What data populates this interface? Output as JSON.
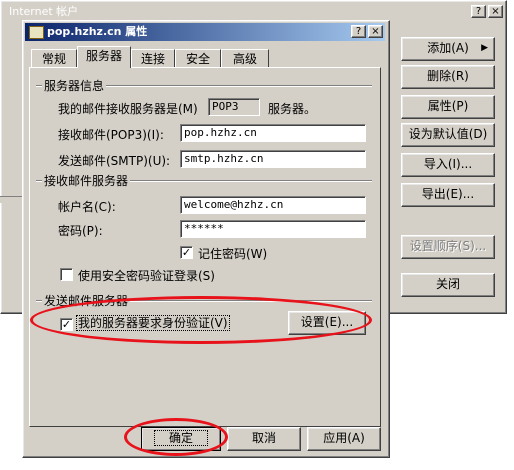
{
  "back_window": {
    "title": "Internet 帐户",
    "help_btn": "?",
    "close_btn": "×",
    "side_buttons": {
      "add": "添加(A)",
      "add_arrow": "▶",
      "remove": "删除(R)",
      "properties": "属性(P)",
      "set_default": "设为默认值(D)",
      "import": "导入(I)...",
      "export": "导出(E)...",
      "set_order": "设置顺序(S)...",
      "close": "关闭"
    }
  },
  "dialog": {
    "title": "pop.hzhz.cn 属性",
    "help_btn": "?",
    "close_btn": "×",
    "tabs": [
      "常规",
      "服务器",
      "连接",
      "安全",
      "高级"
    ],
    "active_tab": "服务器",
    "server_info": {
      "heading": "服务器信息",
      "incoming_type_label": "我的邮件接收服务器是(M)",
      "incoming_type_value": "POP3",
      "incoming_type_suffix": "服务器。",
      "pop3_label": "接收邮件(POP3)(I):",
      "pop3_value": "pop.hzhz.cn",
      "smtp_label": "发送邮件(SMTP)(U):",
      "smtp_value": "smtp.hzhz.cn"
    },
    "incoming": {
      "heading": "接收邮件服务器",
      "account_label": "帐户名(C):",
      "account_value": "welcome@hzhz.cn",
      "password_label": "密码(P):",
      "password_value": "******",
      "remember_label": "记住密码(W)",
      "remember_checked": "✓",
      "spa_label": "使用安全密码验证登录(S)",
      "spa_checked": ""
    },
    "outgoing": {
      "heading": "发送邮件服务器",
      "auth_label": "我的服务器要求身份验证(V)",
      "auth_checked": "✓",
      "settings_button": "设置(E)..."
    },
    "buttons": {
      "ok": "确定",
      "cancel": "取消",
      "apply": "应用(A)"
    }
  },
  "colors": {
    "annotation": "#e8121b",
    "face": "#d4d0c8",
    "title_active": "#0a246a"
  }
}
